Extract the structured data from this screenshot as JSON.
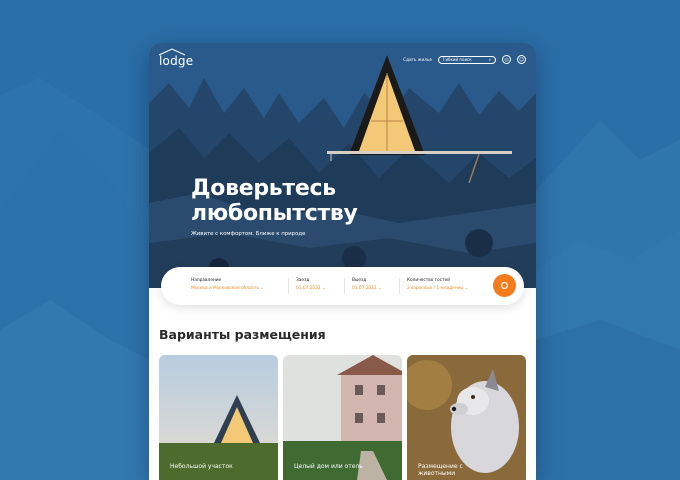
{
  "brand": {
    "logo": "lodge"
  },
  "nav": {
    "host_link": "Сдать жилье",
    "quick_search": "Гибкий поиск",
    "search_icon": "search-icon",
    "globe_icon": "globe-icon",
    "user_icon": "user-icon"
  },
  "hero": {
    "title_line1": "Доверьтесь",
    "title_line2": "любопытству",
    "subtitle": "Живите с комфортом. Ближе к природе"
  },
  "search": {
    "destination": {
      "label": "Направление",
      "value": "Москва и Московская область"
    },
    "checkin": {
      "label": "Заезд",
      "value": "01.07.2022"
    },
    "checkout": {
      "label": "Выезд",
      "value": "01.07.2022"
    },
    "guests": {
      "label": "Количество гостей",
      "value": "2 взрослых / 1 младенец"
    },
    "button_icon": "search-icon"
  },
  "section": {
    "title": "Варианты размещения"
  },
  "tiles": [
    {
      "label": "Небольшой участок"
    },
    {
      "label": "Целый дом или отель"
    },
    {
      "label": "Размещение с животными"
    }
  ],
  "colors": {
    "accent": "#f47c1c",
    "background": "#2a6fa8",
    "hero_dark": "#1f3550"
  }
}
